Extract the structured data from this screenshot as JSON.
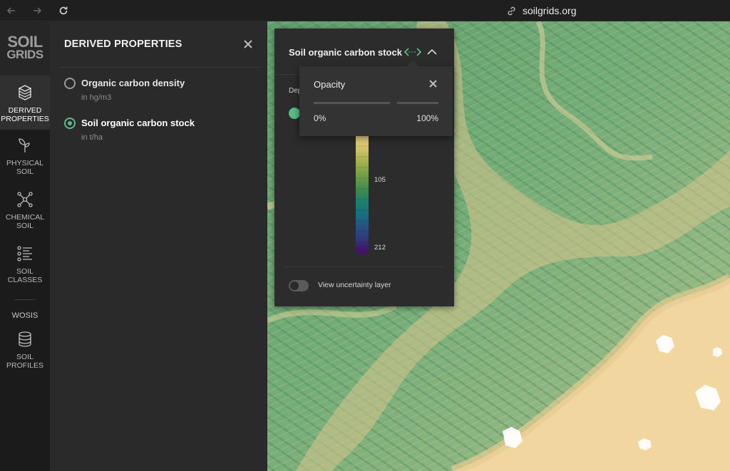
{
  "browser": {
    "url": "soilgrids.org",
    "icons": [
      "back-arrow-icon",
      "forward-arrow-icon",
      "reload-icon",
      "link-icon"
    ]
  },
  "logo": {
    "line1": "SOIL",
    "line2": "GRIDS"
  },
  "rail": {
    "items": [
      {
        "label_1": "DERIVED",
        "label_2": "PROPERTIES",
        "icon": "layers-icon",
        "active": true
      },
      {
        "label_1": "PHYSICAL",
        "label_2": "SOIL",
        "icon": "plant-icon",
        "active": false
      },
      {
        "label_1": "CHEMICAL",
        "label_2": "SOIL",
        "icon": "molecule-icon",
        "active": false
      },
      {
        "label_1": "SOIL",
        "label_2": "CLASSES",
        "icon": "list-icon",
        "active": false
      }
    ],
    "wosis": "WOSIS",
    "profiles": {
      "label_1": "SOIL",
      "label_2": "PROFILES",
      "icon": "database-icon"
    }
  },
  "panel": {
    "title": "DERIVED PROPERTIES",
    "options": [
      {
        "label": "Organic carbon density",
        "unit": "in hg/m3",
        "selected": false
      },
      {
        "label": "Soil organic carbon stock",
        "unit": "in t/ha",
        "selected": true
      }
    ]
  },
  "legend": {
    "title": "Soil organic carbon stock",
    "depth_label": "Dep",
    "ticks": [
      "105",
      "212"
    ],
    "uncertainty_label": "View uncertainty layer",
    "uncertainty_on": false,
    "accent": "#58bd86"
  },
  "opacity": {
    "title": "Opacity",
    "min_label": "0%",
    "max_label": "100%",
    "value": 1.0
  }
}
